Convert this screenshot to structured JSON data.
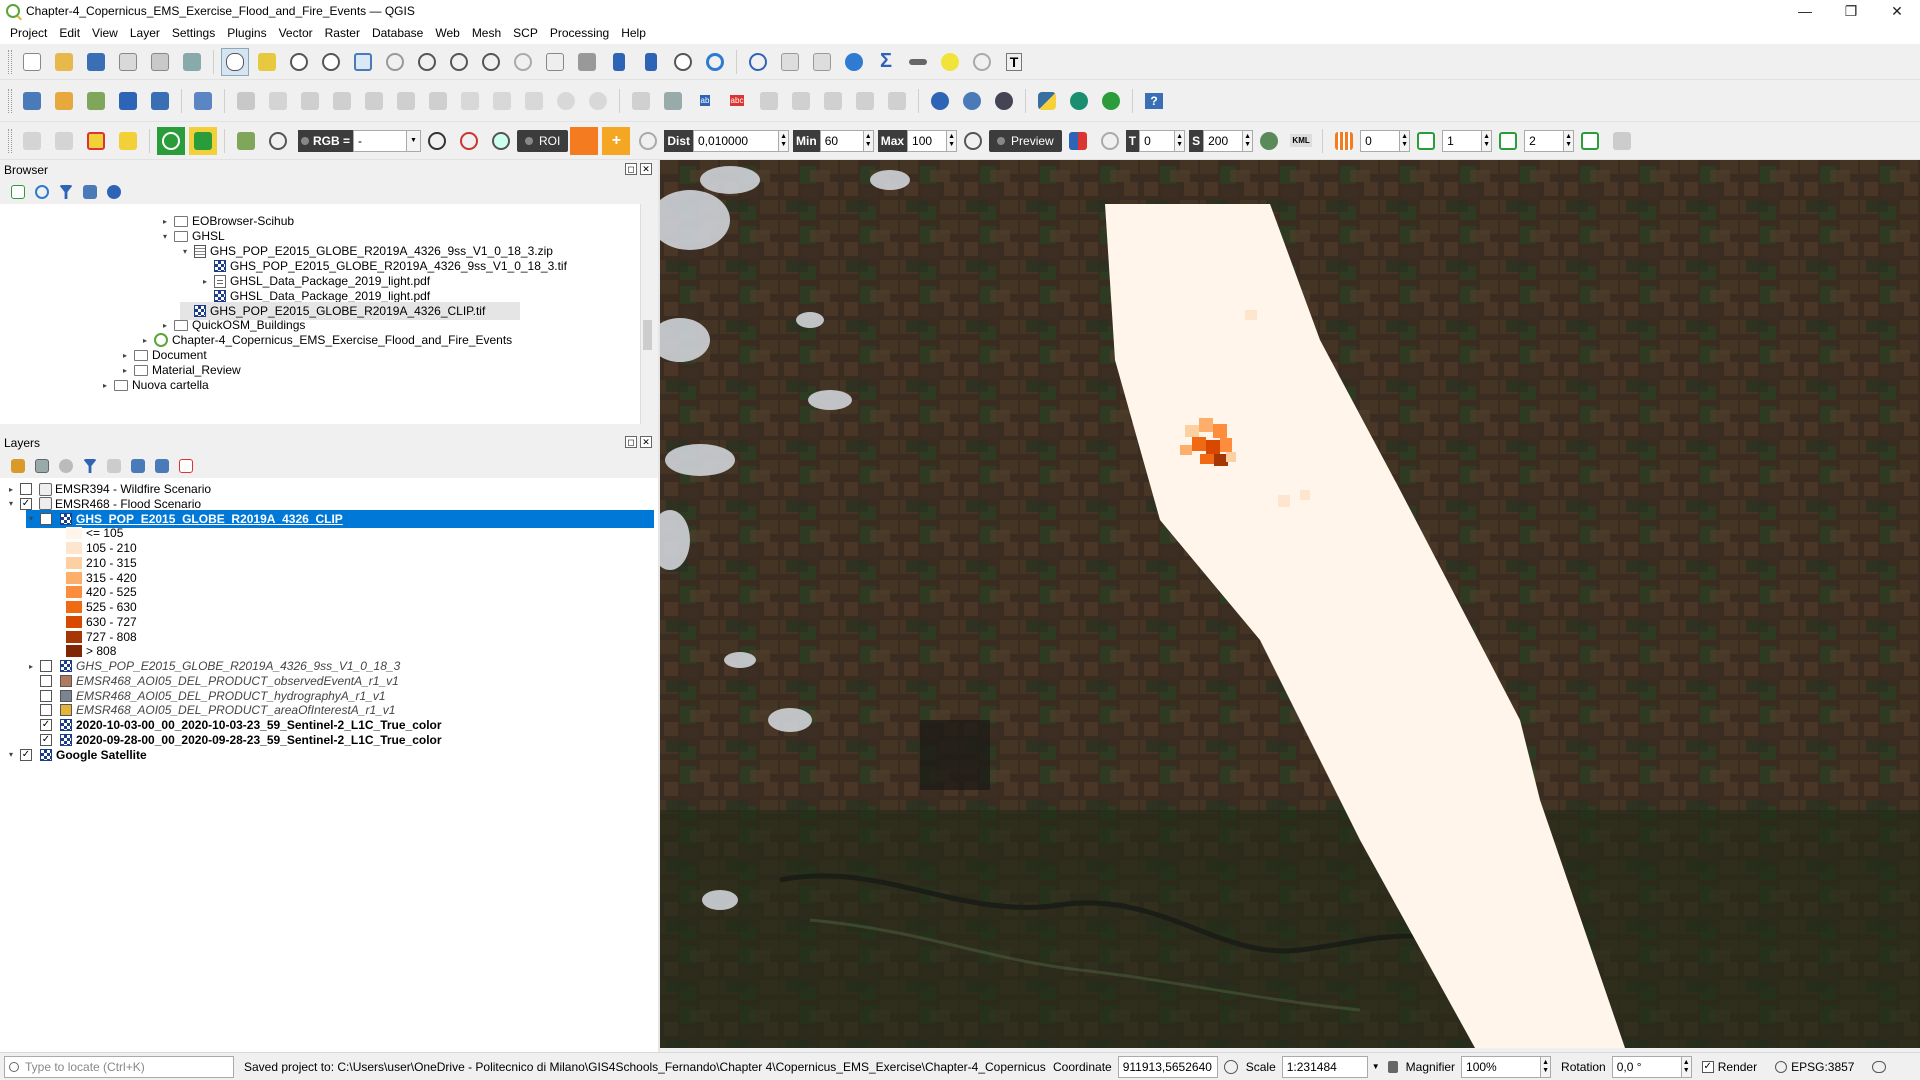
{
  "window": {
    "title": "Chapter-4_Copernicus_EMS_Exercise_Flood_and_Fire_Events — QGIS",
    "minimize": "—",
    "restore": "❐",
    "close": "✕"
  },
  "menu": [
    "Project",
    "Edit",
    "View",
    "Layer",
    "Settings",
    "Plugins",
    "Vector",
    "Raster",
    "Database",
    "Web",
    "Mesh",
    "SCP",
    "Processing",
    "Help"
  ],
  "scp_toolbar": {
    "rgb_label": "RGB =",
    "rgb_value": "-",
    "roi_label": "ROI",
    "dist_label": "Dist",
    "dist_value": "0,010000",
    "min_label": "Min",
    "min_value": "60",
    "max_label": "Max",
    "max_value": "100",
    "preview_label": "Preview",
    "t_label": "T",
    "t_value": "0",
    "s_label": "S",
    "s_value": "200",
    "kml_label": "KML",
    "band_values": [
      "0",
      "1",
      "2"
    ]
  },
  "browser": {
    "title": "Browser",
    "items": [
      {
        "label": "EOBrowser-Scihub",
        "icon": "folder",
        "indent": 1,
        "arrow": "▸"
      },
      {
        "label": "GHSL",
        "icon": "folder",
        "indent": 1,
        "arrow": "▾"
      },
      {
        "label": "GHS_POP_E2015_GLOBE_R2019A_4326_9ss_V1_0_18_3.zip",
        "icon": "zip",
        "indent": 2,
        "arrow": "▾"
      },
      {
        "label": "GHS_POP_E2015_GLOBE_R2019A_4326_9ss_V1_0_18_3.tif",
        "icon": "raster",
        "indent": 3,
        "arrow": ""
      },
      {
        "label": "GHSL_Data_Package_2019_light.pdf",
        "icon": "pdf",
        "indent": 3,
        "arrow": "▸"
      },
      {
        "label": "GHSL_Data_Package_2019_light.pdf",
        "icon": "raster",
        "indent": 3,
        "arrow": ""
      },
      {
        "label": "GHS_POP_E2015_GLOBE_R2019A_4326_CLIP.tif",
        "icon": "raster",
        "indent": 2,
        "arrow": "",
        "selected": true
      },
      {
        "label": "QuickOSM_Buildings",
        "icon": "folder",
        "indent": 1,
        "arrow": "▸"
      },
      {
        "label": "Chapter-4_Copernicus_EMS_Exercise_Flood_and_Fire_Events",
        "icon": "qgs",
        "indent": 0,
        "arrow": "▸"
      },
      {
        "label": "Document",
        "icon": "folder",
        "indent": -1,
        "arrow": "▸"
      },
      {
        "label": "Material_Review",
        "icon": "folder",
        "indent": -1,
        "arrow": "▸"
      },
      {
        "label": "Nuova cartella",
        "icon": "folder",
        "indent": -2,
        "arrow": "▸"
      }
    ]
  },
  "layers": {
    "title": "Layers",
    "groups": [
      {
        "label": "EMSR394 - Wildfire Scenario",
        "checked": false
      },
      {
        "label": "EMSR468 - Flood Scenario",
        "checked": true
      }
    ],
    "selected_layer": "GHS_POP_E2015_GLOBE_R2019A_4326_CLIP",
    "legend": [
      {
        "label": "<= 105",
        "color": "#fff5eb"
      },
      {
        "label": "105 - 210",
        "color": "#fee6ce"
      },
      {
        "label": "210 - 315",
        "color": "#fdd0a2"
      },
      {
        "label": "315 - 420",
        "color": "#fdae6b"
      },
      {
        "label": "420 - 525",
        "color": "#fd8d3c"
      },
      {
        "label": "525 - 630",
        "color": "#f16913"
      },
      {
        "label": "630 - 727",
        "color": "#d94801"
      },
      {
        "label": "727 - 808",
        "color": "#a63603"
      },
      {
        "label": "> 808",
        "color": "#7f2704"
      }
    ],
    "other_layers": [
      {
        "label": "GHS_POP_E2015_GLOBE_R2019A_4326_9ss_V1_0_18_3",
        "checked": false,
        "icon": "raster",
        "italic": true,
        "arrow": "▸"
      },
      {
        "label": "EMSR468_AOI05_DEL_PRODUCT_observedEventA_r1_v1",
        "checked": false,
        "icon": "#b07a5e",
        "italic": true
      },
      {
        "label": "EMSR468_AOI05_DEL_PRODUCT_hydrographyA_r1_v1",
        "checked": false,
        "icon": "#7b8591",
        "italic": true
      },
      {
        "label": "EMSR468_AOI05_DEL_PRODUCT_areaOfInterestA_r1_v1",
        "checked": false,
        "icon": "#e4b33a",
        "italic": true
      },
      {
        "label": "2020-10-03-00_00_2020-10-03-23_59_Sentinel-2_L1C_True_color",
        "checked": true,
        "icon": "raster",
        "bold": true
      },
      {
        "label": "2020-09-28-00_00_2020-09-28-23_59_Sentinel-2_L1C_True_color",
        "checked": true,
        "icon": "raster",
        "bold": true
      }
    ],
    "base_layer": {
      "label": "Google Satellite",
      "checked": true
    }
  },
  "status": {
    "locate_placeholder": "Type to locate (Ctrl+K)",
    "message": "Saved project to: C:\\Users\\user\\OneDrive - Politecnico di Milano\\GIS4Schools_Fernando\\Chapter 4\\Copernicus_EMS_Exercise\\Chapter-4_Copernicus",
    "coordinate_label": "Coordinate",
    "coordinate_value": "911913,5652640",
    "scale_label": "Scale",
    "scale_value": "1:231484",
    "magnifier_label": "Magnifier",
    "magnifier_value": "100%",
    "rotation_label": "Rotation",
    "rotation_value": "0,0 °",
    "render_label": "Render",
    "crs": "EPSG:3857"
  }
}
